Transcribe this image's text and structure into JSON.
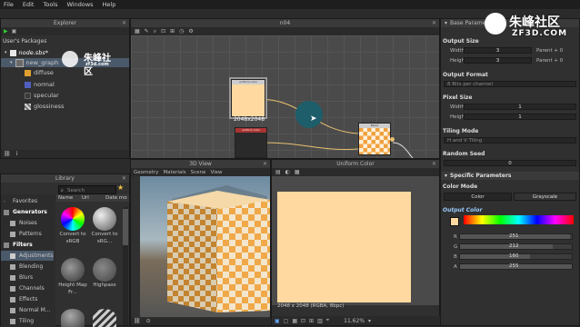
{
  "menu": [
    "File",
    "Edit",
    "Tools",
    "Windows",
    "Help"
  ],
  "explorer": {
    "title": "Explorer",
    "header": "User's Packages",
    "package": "node.sbs*",
    "graph": "new_graph",
    "items": [
      "diffuse",
      "normal",
      "specular",
      "glossiness"
    ]
  },
  "graph_view": {
    "title": "n04",
    "node_label": "2048x2048",
    "node_header": "uniform color",
    "node_header2": "uniform color",
    "blend_label": "Blend"
  },
  "library": {
    "title": "Library",
    "search_placeholder": "Search",
    "columns": [
      "Name",
      "Url",
      "Date mo"
    ],
    "categories": [
      "Favorites",
      "Generators",
      "Noises",
      "Patterns",
      "Filters",
      "Adjustments",
      "Blending",
      "Blurs",
      "Channels",
      "Effects",
      "Normal M...",
      "Tiling"
    ],
    "items": [
      {
        "name": "Convert to sRGB"
      },
      {
        "name": "Convert to sRG..."
      },
      {
        "name": "Height Map Fr..."
      },
      {
        "name": "Highpass"
      }
    ]
  },
  "view3d": {
    "title": "3D View",
    "menus": [
      "Geometry",
      "Materials",
      "Scene",
      "View"
    ]
  },
  "view2d": {
    "title": "Uniform Color",
    "status": "2048 x 2048 (RGBA, 8bpc)",
    "zoom": "11.62%",
    "swatch_color": "#ffd9a0"
  },
  "params": {
    "title": "Base Parameters",
    "output_size": "Output Size",
    "width_label": "Width",
    "width_value": "3",
    "width_parent": "Parent + 0",
    "height_label": "Height",
    "height_value": "3",
    "height_parent": "Parent + 0",
    "output_format": "Output Format",
    "format_value": "8 Bits per channel",
    "pixel_size": "Pixel Size",
    "ps_width": "1",
    "ps_height": "1",
    "tiling_mode": "Tiling Mode",
    "tiling_value": "H and V Tiling",
    "random_seed": "Random Seed",
    "seed_value": "0",
    "specific": "Specific Parameters",
    "color_mode": "Color Mode",
    "mode_color": "Color",
    "mode_gray": "Grayscale",
    "output_color": "Output Color",
    "channels": [
      {
        "label": "R",
        "value": "251",
        "fill": 0.98
      },
      {
        "label": "G",
        "value": "212",
        "fill": 0.83
      },
      {
        "label": "B",
        "value": "160",
        "fill": 0.63
      },
      {
        "label": "A",
        "value": "255",
        "fill": 1.0
      }
    ]
  },
  "watermark": {
    "text": "朱峰社区",
    "sub": "ZF3D.COM"
  }
}
